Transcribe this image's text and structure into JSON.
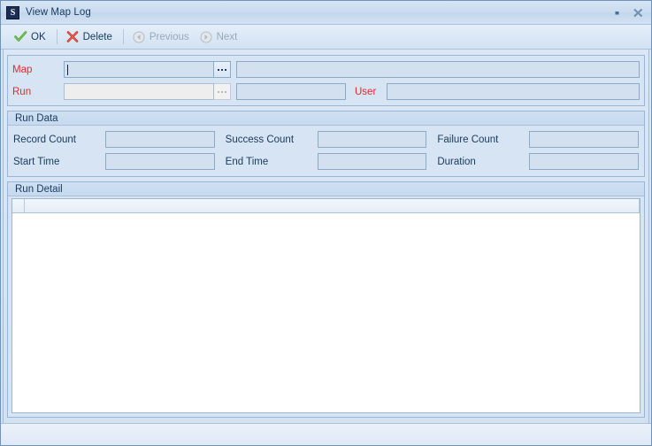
{
  "window": {
    "title": "View Map Log",
    "app_icon": "app-icon",
    "restore_button": "restore-icon",
    "close_button": "close-icon"
  },
  "toolbar": {
    "buttons": [
      {
        "label": "OK",
        "icon": "check-icon",
        "enabled": true
      },
      {
        "label": "Delete",
        "icon": "x-mark-icon",
        "enabled": true
      },
      {
        "label": "Previous",
        "icon": "arrow-left-circle-icon",
        "enabled": false
      },
      {
        "label": "Next",
        "icon": "arrow-right-circle-icon",
        "enabled": false
      }
    ]
  },
  "form": {
    "map": {
      "label": "Map",
      "value": "",
      "browse_label": "...",
      "description_value": ""
    },
    "run": {
      "label": "Run",
      "value": "",
      "browse_label": "...",
      "description_value": ""
    },
    "user": {
      "label": "User",
      "value": ""
    }
  },
  "run_data": {
    "title": "Run Data",
    "fields": [
      {
        "label": "Record Count",
        "value": ""
      },
      {
        "label": "Success Count",
        "value": ""
      },
      {
        "label": "Failure Count",
        "value": ""
      },
      {
        "label": "Start Time",
        "value": ""
      },
      {
        "label": "End Time",
        "value": ""
      },
      {
        "label": "Duration",
        "value": ""
      }
    ]
  },
  "run_detail": {
    "title": "Run Detail",
    "columns": [
      "",
      ""
    ],
    "rows": []
  },
  "colors": {
    "required_label": "#e8272c",
    "label": "#1b3c60",
    "panel_background": "#d7e4f3",
    "field_background": "#d3e0f0",
    "disabled_field_background": "#efeeee",
    "border": "#9ab6d4",
    "ok_icon": "#3f9a28",
    "delete_icon": "#d8322b",
    "disabled_text": "#9aa8b6"
  }
}
